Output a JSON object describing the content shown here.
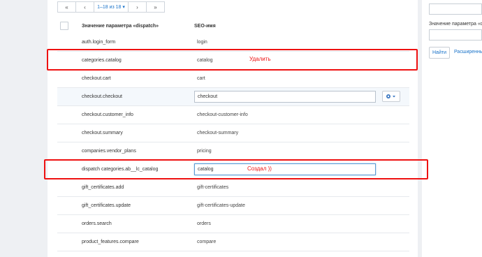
{
  "pagination": {
    "first": "«",
    "prev": "‹",
    "current": "1–18 из 18",
    "dropdown_icon": "▾",
    "next": "›",
    "last": "»"
  },
  "table": {
    "headers": {
      "param": "Значение параметра «dispatch»",
      "seo": "SEO-имя"
    },
    "rows": [
      {
        "name": "auth.login_form",
        "seo": "login"
      },
      {
        "name": "categories.catalog",
        "seo": "catalog"
      },
      {
        "name": "checkout.cart",
        "seo": "cart"
      },
      {
        "name": "checkout.checkout",
        "seo": "checkout"
      },
      {
        "name": "checkout.customer_info",
        "seo": "checkout-customer-info"
      },
      {
        "name": "checkout.summary",
        "seo": "checkout-summary"
      },
      {
        "name": "companies.vendor_plans",
        "seo": "pricing"
      },
      {
        "name": "dispatch categories.ab__lc_catalog",
        "seo": "catalog"
      },
      {
        "name": "gift_certificates.add",
        "seo": "gift-certificates"
      },
      {
        "name": "gift_certificates.update",
        "seo": "gift-certificates-update"
      },
      {
        "name": "orders.search",
        "seo": "orders"
      },
      {
        "name": "product_features.compare",
        "seo": "compare"
      }
    ]
  },
  "annotations": {
    "delete": "Удалить",
    "created": "Создал ))"
  },
  "sidebar": {
    "param_label": "Значение параметра «di",
    "find_button": "Найти",
    "advanced_link": "Расширенный"
  },
  "colors": {
    "annotation": "#ee1111",
    "link": "#1a73c9"
  }
}
